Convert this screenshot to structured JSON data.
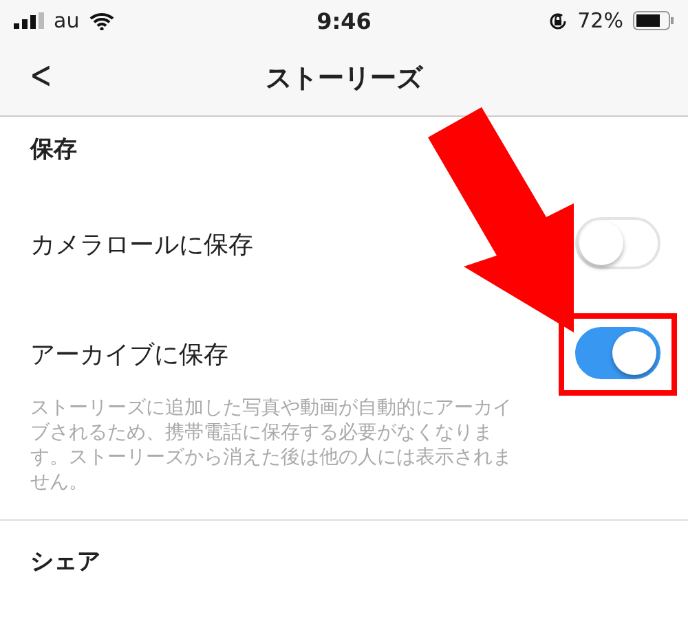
{
  "status_bar": {
    "carrier": "au",
    "time": "9:46",
    "battery": "72%"
  },
  "nav": {
    "back": "<",
    "title": "ストーリーズ"
  },
  "sections": [
    {
      "header": "保存",
      "rows": [
        {
          "label": "カメラロールに保存",
          "on": false,
          "highlighted": false
        },
        {
          "label": "アーカイブに保存",
          "on": true,
          "highlighted": true,
          "description": "ストーリーズに追加した写真や動画が自動的にアーカイブされるため、携帯電話に保存する必要がなくなります。ストーリーズから消えた後は他の人には表示されません。"
        }
      ]
    },
    {
      "header": "シェア"
    }
  ]
}
